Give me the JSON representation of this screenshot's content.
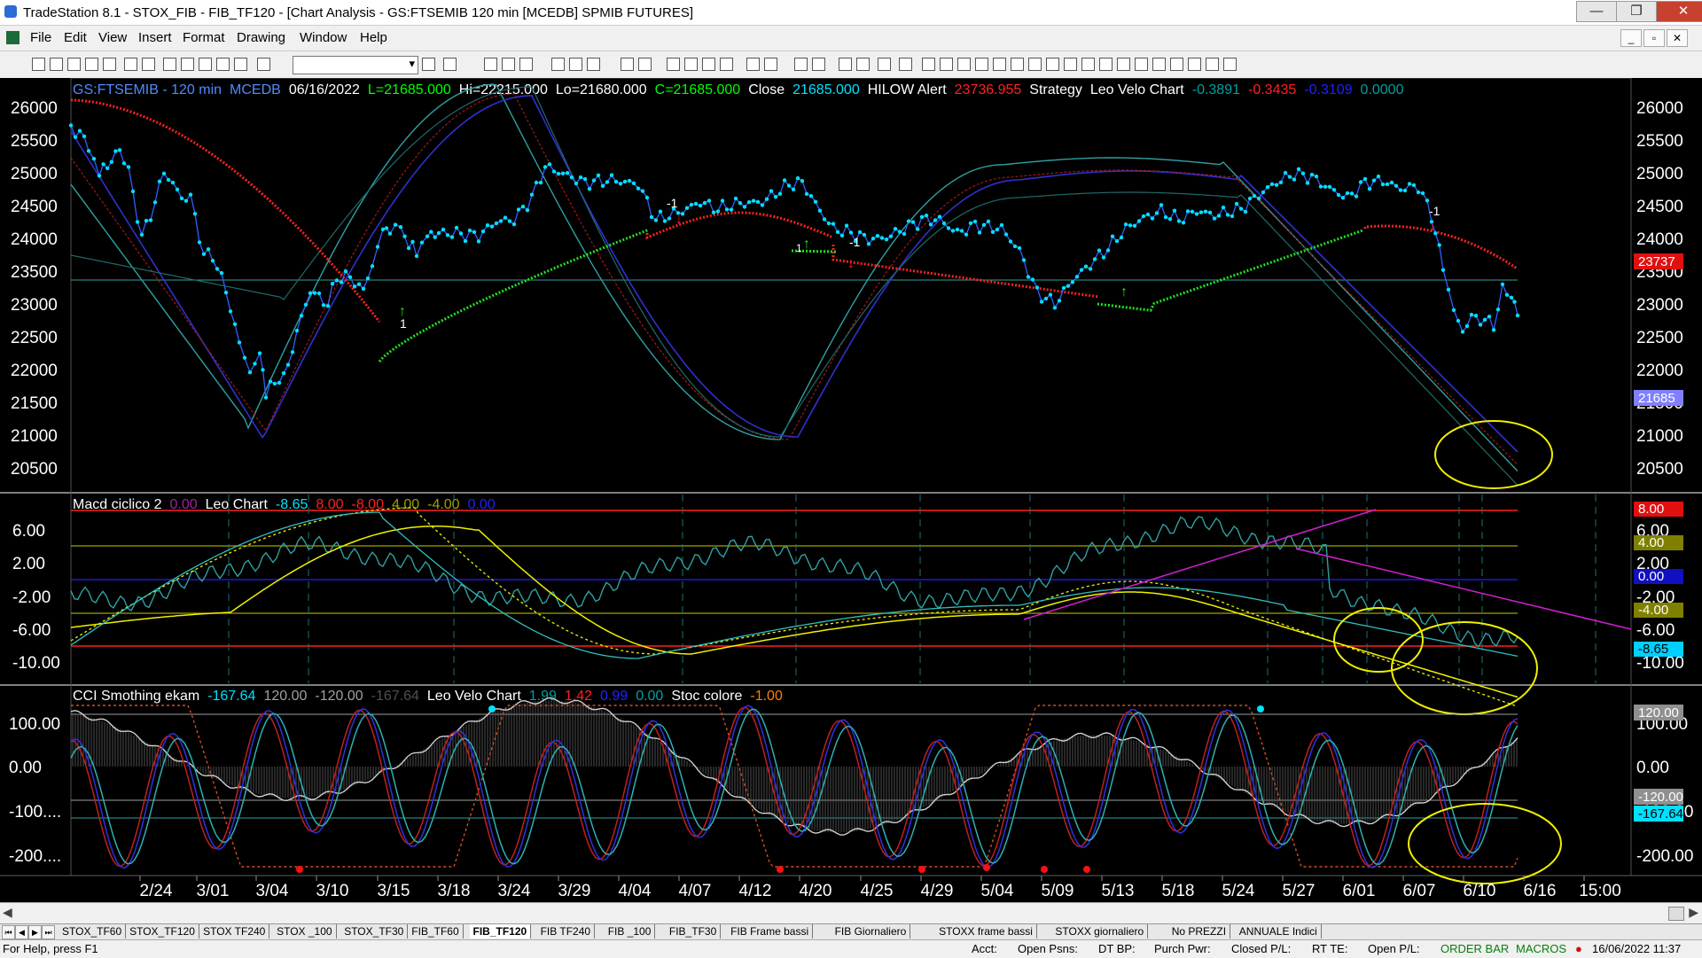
{
  "window": {
    "title": "TradeStation 8.1 - STOX_FIB - FIB_TF120 - [Chart Analysis - GS:FTSEMIB  120 min  [MCEDB] SPMIB FUTURES]",
    "minimize": "—",
    "maximize": "❐",
    "close": "✕"
  },
  "menu": {
    "items": [
      "File",
      "Edit",
      "View",
      "Insert",
      "Format",
      "Drawing",
      "Window",
      "Help"
    ]
  },
  "colors": {
    "price": "#00e0ff",
    "red_curve": "#ff2020",
    "green_curve": "#20e020",
    "blue_band": "#3030d0",
    "teal_band": "#30a0a0",
    "dark_red_band": "#a01818",
    "yellow": "#f0f000",
    "magenta": "#d020d0"
  },
  "price_panel": {
    "header": [
      {
        "text": "GS:FTSEMIB - 120 min",
        "color": "#4f8bff"
      },
      {
        "text": "MCEDB",
        "color": "#4f8bff"
      },
      {
        "text": "06/16/2022",
        "color": "#ffffff"
      },
      {
        "text": "L=21685.000",
        "color": "#00ff00"
      },
      {
        "text": "Hi=22215.000",
        "color": "#ffffff"
      },
      {
        "text": "Lo=21680.000",
        "color": "#ffffff"
      },
      {
        "text": "C=21685.000",
        "color": "#00ff00"
      },
      {
        "text": "Close",
        "color": "#ffffff"
      },
      {
        "text": "21685.000",
        "color": "#00e0ff"
      },
      {
        "text": "HILOW Alert",
        "color": "#ffffff"
      },
      {
        "text": "23736.955",
        "color": "#ff2020"
      },
      {
        "text": "Strategy",
        "color": "#ffffff"
      },
      {
        "text": "Leo Velo Chart",
        "color": "#ffffff"
      },
      {
        "text": "-0.3891",
        "color": "#00a0a0"
      },
      {
        "text": "-0.3435",
        "color": "#ff2020"
      },
      {
        "text": "-0.3109",
        "color": "#2020ff"
      },
      {
        "text": "0.0000",
        "color": "#00a0a0"
      }
    ],
    "y_ticks": [
      "26000",
      "25500",
      "25000",
      "24500",
      "24000",
      "23500",
      "23000",
      "22500",
      "22000",
      "21500",
      "21000",
      "20500"
    ],
    "right_ticks": [
      "26000",
      "25500",
      "25000",
      "24500",
      "24000",
      "23500",
      "23000",
      "22500",
      "22000",
      "21500",
      "21000",
      "20500"
    ],
    "badge_red": "23737",
    "badge_price": "21685",
    "markers": [
      "-1",
      "1",
      "-1",
      "-1",
      "1"
    ]
  },
  "macd_panel": {
    "header": [
      {
        "text": "Macd ciclico 2",
        "color": "#ffffff"
      },
      {
        "text": "0.00",
        "color": "#a020a0"
      },
      {
        "text": "Leo Chart",
        "color": "#ffffff"
      },
      {
        "text": "-8.65",
        "color": "#00e0ff"
      },
      {
        "text": "8.00",
        "color": "#ff2020"
      },
      {
        "text": "-8.00",
        "color": "#ff2020"
      },
      {
        "text": "4.00",
        "color": "#a0a000"
      },
      {
        "text": "-4.00",
        "color": "#a0a000"
      },
      {
        "text": "0.00",
        "color": "#2020ff"
      }
    ],
    "y_ticks": [
      "6.00",
      "2.00",
      "-2.00",
      "-6.00",
      "-10.00"
    ],
    "right_ticks": [
      "6.00",
      "2.00",
      "-2.00",
      "-6.00",
      "-10.00"
    ],
    "badges": [
      "8.00",
      "4.00",
      "0.00",
      "-4.00",
      "-8.65"
    ]
  },
  "cci_panel": {
    "header": [
      {
        "text": "CCI Smothing ekam",
        "color": "#ffffff"
      },
      {
        "text": "-167.64",
        "color": "#00e0ff"
      },
      {
        "text": "120.00",
        "color": "#a0a0a0"
      },
      {
        "text": "-120.00",
        "color": "#a0a0a0"
      },
      {
        "text": "-167.64",
        "color": "#505050"
      },
      {
        "text": "Leo Velo Chart",
        "color": "#ffffff"
      },
      {
        "text": "1.99",
        "color": "#00a0a0"
      },
      {
        "text": "1.42",
        "color": "#ff2020"
      },
      {
        "text": "0.99",
        "color": "#2020ff"
      },
      {
        "text": "0.00",
        "color": "#00a0a0"
      },
      {
        "text": "Stoc colore",
        "color": "#ffffff"
      },
      {
        "text": "-1.00",
        "color": "#ff8000"
      }
    ],
    "y_ticks": [
      "100.00",
      "0.00",
      "-100....",
      "-200...."
    ],
    "right_ticks": [
      "100.00",
      "0.00",
      "-100.00",
      "-200.00"
    ],
    "badges": [
      "120.00",
      "-120.00",
      "-167.64"
    ]
  },
  "x_axis": [
    "2/24",
    "3/01",
    "3/04",
    "3/10",
    "3/15",
    "3/18",
    "3/24",
    "3/29",
    "4/04",
    "4/07",
    "4/12",
    "4/20",
    "4/25",
    "4/29",
    "5/04",
    "5/09",
    "5/13",
    "5/18",
    "5/24",
    "5/27",
    "6/01",
    "6/07",
    "6/10",
    "6/16",
    "15:00"
  ],
  "tabs": [
    "STOX_TF60",
    "STOX_TF120",
    "STOX TF240",
    "STOX _100",
    "STOX_TF30",
    "FIB_TF60",
    "FIB_TF120",
    "FIB TF240",
    "FIB _100",
    "FIB_TF30",
    "FIB Frame bassi",
    "FIB Giornaliero",
    "STOXX frame bassi",
    "STOXX giornaliero",
    "No PREZZI",
    "ANNUALE Indici"
  ],
  "active_tab": "FIB_TF120",
  "status": {
    "help": "For Help, press F1",
    "acct": "Acct:",
    "open_psns": "Open Psns:",
    "dt_bp": "DT BP:",
    "purch_pwr": "Purch Pwr:",
    "closed_pl": "Closed P/L:",
    "rt_te": "RT TE:",
    "open_pl": "Open P/L:",
    "order_bar": "ORDER BAR",
    "macros": "MACROS",
    "datetime": "16/06/2022 11:37"
  }
}
